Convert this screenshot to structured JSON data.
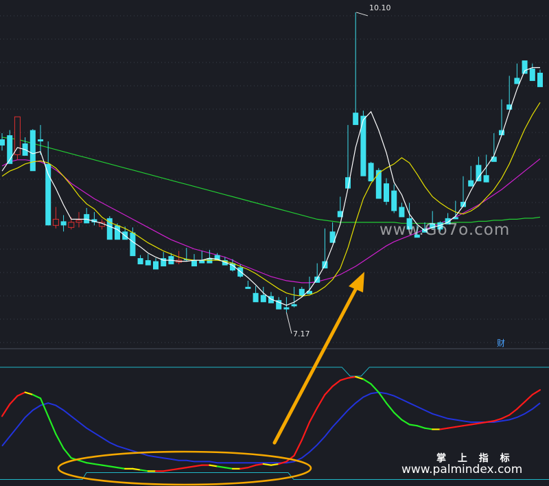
{
  "labels": {
    "high_price": "10.10",
    "low_price": "7.17",
    "cai_marker": "财",
    "watermark_center": "www.Go7o.com",
    "watermark_brand": "掌 上 指 标",
    "watermark_site": "www.palmindex.com"
  },
  "colors": {
    "background": "#1b1d24",
    "up": "#e03030",
    "down": "#3ee0ee",
    "ma5": "#ffffff",
    "ma10": "#e6e000",
    "ma20": "#d020d0",
    "ma60": "#22cc33",
    "grid": "#3a3f4a",
    "panel_line": "#1fb8c8",
    "kdj_fast_up": "#ff1a1a",
    "kdj_fast_down": "#22ee22",
    "kdj_fast_turn": "#ffee00",
    "kdj_slow": "#2233dd",
    "annotation": "#f5a800"
  },
  "chart_data": {
    "type": "candlestick",
    "price_range": [
      6.95,
      10.18
    ],
    "high": 10.1,
    "low": 7.17,
    "candles": [
      [
        8.86,
        8.92,
        8.75,
        8.8
      ],
      [
        8.9,
        8.95,
        8.68,
        8.62
      ],
      [
        8.71,
        9.02,
        8.66,
        9.08
      ],
      [
        8.82,
        8.88,
        8.75,
        8.7
      ],
      [
        8.95,
        8.96,
        8.6,
        8.55
      ],
      [
        8.86,
        9.0,
        8.71,
        8.84
      ],
      [
        8.62,
        8.84,
        8.08,
        8.02
      ],
      [
        8.02,
        8.2,
        7.99,
        8.08
      ],
      [
        8.06,
        8.12,
        7.96,
        8.02
      ],
      [
        8.0,
        8.1,
        7.98,
        8.05
      ],
      [
        8.05,
        8.15,
        8.0,
        8.07
      ],
      [
        8.13,
        8.19,
        8.07,
        8.04
      ],
      [
        8.08,
        8.15,
        8.02,
        8.05
      ],
      [
        8.01,
        8.08,
        7.98,
        8.05
      ],
      [
        8.09,
        8.11,
        7.89,
        7.88
      ],
      [
        8.02,
        8.04,
        7.9,
        7.88
      ],
      [
        7.96,
        8.01,
        7.89,
        7.88
      ],
      [
        7.95,
        8.0,
        7.75,
        7.72
      ],
      [
        7.7,
        7.73,
        7.68,
        7.64
      ],
      [
        7.68,
        7.74,
        7.65,
        7.63
      ],
      [
        7.67,
        7.7,
        7.59,
        7.59
      ],
      [
        7.7,
        7.76,
        7.63,
        7.62
      ],
      [
        7.72,
        7.75,
        7.64,
        7.64
      ],
      [
        7.66,
        7.77,
        7.64,
        7.68
      ],
      [
        7.69,
        7.8,
        7.67,
        7.68
      ],
      [
        7.68,
        7.74,
        7.63,
        7.62
      ],
      [
        7.68,
        7.77,
        7.67,
        7.65
      ],
      [
        7.7,
        7.78,
        7.68,
        7.65
      ],
      [
        7.73,
        7.75,
        7.69,
        7.68
      ],
      [
        7.68,
        7.71,
        7.63,
        7.63
      ],
      [
        7.65,
        7.69,
        7.57,
        7.58
      ],
      [
        7.61,
        7.64,
        7.51,
        7.52
      ],
      [
        7.42,
        7.48,
        7.42,
        7.4
      ],
      [
        7.36,
        7.43,
        7.31,
        7.27
      ],
      [
        7.34,
        7.42,
        7.31,
        7.27
      ],
      [
        7.33,
        7.37,
        7.3,
        7.26
      ],
      [
        7.29,
        7.32,
        7.24,
        7.2
      ],
      [
        7.22,
        7.32,
        7.17,
        7.2
      ],
      [
        7.25,
        7.42,
        7.22,
        7.23
      ],
      [
        7.4,
        7.42,
        7.32,
        7.33
      ],
      [
        7.38,
        7.52,
        7.36,
        7.35
      ],
      [
        7.52,
        7.65,
        7.49,
        7.46
      ],
      [
        7.67,
        7.99,
        7.62,
        7.6
      ],
      [
        7.96,
        8.05,
        7.88,
        7.85
      ],
      [
        8.16,
        8.3,
        8.15,
        8.1
      ],
      [
        8.49,
        9.0,
        8.44,
        8.38
      ],
      [
        9.12,
        10.1,
        9.06,
        9.0
      ],
      [
        9.09,
        9.14,
        8.51,
        8.5
      ],
      [
        8.63,
        8.64,
        8.54,
        8.45
      ],
      [
        8.56,
        8.58,
        8.32,
        8.28
      ],
      [
        8.43,
        8.48,
        8.22,
        8.25
      ],
      [
        8.36,
        8.42,
        8.14,
        8.16
      ],
      [
        8.2,
        8.24,
        8.11,
        8.1
      ],
      [
        8.09,
        8.24,
        8.0,
        7.98
      ],
      [
        7.93,
        8.02,
        7.92,
        7.9
      ],
      [
        7.99,
        8.05,
        7.97,
        7.95
      ],
      [
        8.04,
        8.16,
        8.02,
        7.99
      ],
      [
        8.05,
        8.06,
        7.96,
        7.98
      ],
      [
        8.09,
        8.14,
        8.04,
        8.03
      ],
      [
        8.1,
        8.26,
        8.09,
        8.08
      ],
      [
        8.25,
        8.5,
        8.22,
        8.2
      ],
      [
        8.46,
        8.6,
        8.43,
        8.4
      ],
      [
        8.61,
        8.69,
        8.46,
        8.45
      ],
      [
        8.51,
        8.71,
        8.44,
        8.44
      ],
      [
        8.69,
        8.92,
        8.66,
        8.64
      ],
      [
        8.95,
        9.25,
        8.92,
        8.9
      ],
      [
        9.2,
        9.48,
        9.17,
        9.15
      ],
      [
        9.46,
        9.6,
        9.42,
        9.4
      ],
      [
        9.63,
        9.6,
        9.52,
        9.5
      ],
      [
        9.55,
        9.6,
        9.44,
        9.43
      ],
      [
        9.51,
        9.54,
        9.4,
        9.37
      ]
    ],
    "ma5": [
      8.55,
      8.66,
      8.78,
      8.76,
      8.72,
      8.74,
      8.52,
      8.38,
      8.22,
      8.08,
      8.08,
      8.08,
      8.06,
      8.04,
      8.01,
      7.98,
      7.92,
      7.86,
      7.81,
      7.75,
      7.71,
      7.68,
      7.68,
      7.67,
      7.67,
      7.68,
      7.68,
      7.7,
      7.69,
      7.66,
      7.63,
      7.57,
      7.51,
      7.44,
      7.36,
      7.3,
      7.27,
      7.24,
      7.27,
      7.32,
      7.39,
      7.5,
      7.63,
      7.82,
      8.03,
      8.38,
      8.78,
      9.05,
      9.13,
      8.95,
      8.73,
      8.44,
      8.32,
      8.13,
      8.03,
      7.97,
      8.0,
      8.02,
      8.05,
      8.11,
      8.21,
      8.36,
      8.49,
      8.59,
      8.7,
      8.9,
      9.13,
      9.35,
      9.53,
      9.56,
      9.56
    ],
    "ma10": [
      8.5,
      8.55,
      8.58,
      8.62,
      8.64,
      8.65,
      8.63,
      8.58,
      8.5,
      8.41,
      8.31,
      8.23,
      8.18,
      8.1,
      8.05,
      8.02,
      7.99,
      7.95,
      7.9,
      7.85,
      7.81,
      7.77,
      7.74,
      7.71,
      7.69,
      7.68,
      7.68,
      7.68,
      7.68,
      7.67,
      7.65,
      7.62,
      7.59,
      7.55,
      7.5,
      7.45,
      7.4,
      7.36,
      7.34,
      7.33,
      7.34,
      7.37,
      7.42,
      7.49,
      7.6,
      7.8,
      8.05,
      8.28,
      8.43,
      8.53,
      8.58,
      8.62,
      8.68,
      8.63,
      8.52,
      8.4,
      8.3,
      8.24,
      8.19,
      8.15,
      8.13,
      8.16,
      8.21,
      8.29,
      8.37,
      8.48,
      8.62,
      8.79,
      8.96,
      9.1,
      9.22
    ],
    "ma20": [
      8.6,
      8.64,
      8.66,
      8.66,
      8.65,
      8.64,
      8.61,
      8.56,
      8.5,
      8.43,
      8.38,
      8.33,
      8.28,
      8.24,
      8.2,
      8.16,
      8.12,
      8.08,
      8.04,
      8.0,
      7.96,
      7.92,
      7.88,
      7.85,
      7.82,
      7.79,
      7.77,
      7.75,
      7.73,
      7.71,
      7.68,
      7.64,
      7.61,
      7.58,
      7.55,
      7.52,
      7.5,
      7.48,
      7.47,
      7.46,
      7.46,
      7.47,
      7.49,
      7.51,
      7.54,
      7.58,
      7.62,
      7.67,
      7.72,
      7.77,
      7.82,
      7.86,
      7.89,
      7.92,
      7.95,
      7.98,
      8.01,
      8.04,
      8.07,
      8.1,
      8.14,
      8.18,
      8.22,
      8.27,
      8.32,
      8.37,
      8.43,
      8.49,
      8.55,
      8.61,
      8.67
    ],
    "ma60": [
      8.88,
      8.87,
      8.86,
      8.84,
      8.82,
      8.8,
      8.78,
      8.76,
      8.74,
      8.72,
      8.7,
      8.68,
      8.66,
      8.64,
      8.62,
      8.6,
      8.58,
      8.56,
      8.54,
      8.52,
      8.5,
      8.48,
      8.46,
      8.44,
      8.42,
      8.4,
      8.38,
      8.36,
      8.34,
      8.32,
      8.3,
      8.28,
      8.26,
      8.24,
      8.22,
      8.2,
      8.18,
      8.16,
      8.14,
      8.12,
      8.1,
      8.08,
      8.07,
      8.06,
      8.05,
      8.05,
      8.05,
      8.05,
      8.05,
      8.05,
      8.05,
      8.05,
      8.04,
      8.04,
      8.04,
      8.04,
      8.04,
      8.04,
      8.04,
      8.05,
      8.05,
      8.05,
      8.06,
      8.06,
      8.07,
      8.07,
      8.08,
      8.08,
      8.09,
      8.09,
      8.1
    ],
    "indicator": {
      "range": [
        0,
        100
      ],
      "upper_band": 96,
      "lower_band": 2,
      "fast": [
        55,
        65,
        72,
        75,
        73,
        70,
        55,
        40,
        28,
        20,
        18,
        16,
        15,
        14,
        13,
        12,
        11,
        11,
        10,
        9,
        9,
        9,
        10,
        11,
        12,
        13,
        14,
        14,
        13,
        12,
        11,
        11,
        12,
        14,
        15,
        14,
        15,
        17,
        22,
        35,
        50,
        62,
        73,
        80,
        85,
        87,
        88,
        86,
        82,
        75,
        66,
        58,
        52,
        48,
        47,
        45,
        44,
        44,
        45,
        46,
        47,
        48,
        49,
        50,
        51,
        53,
        56,
        61,
        67,
        73,
        77
      ],
      "slow": [
        30,
        38,
        46,
        54,
        60,
        64,
        66,
        64,
        60,
        55,
        50,
        45,
        41,
        37,
        33,
        30,
        28,
        26,
        24,
        22,
        21,
        20,
        19,
        18,
        18,
        17,
        17,
        17,
        16,
        16,
        16,
        16,
        16,
        16,
        16,
        16,
        16,
        16,
        17,
        20,
        25,
        31,
        38,
        46,
        53,
        60,
        66,
        71,
        74,
        75,
        74,
        72,
        69,
        66,
        63,
        60,
        57,
        55,
        53,
        52,
        51,
        50,
        50,
        50,
        50,
        51,
        52,
        54,
        57,
        61,
        66
      ]
    }
  }
}
